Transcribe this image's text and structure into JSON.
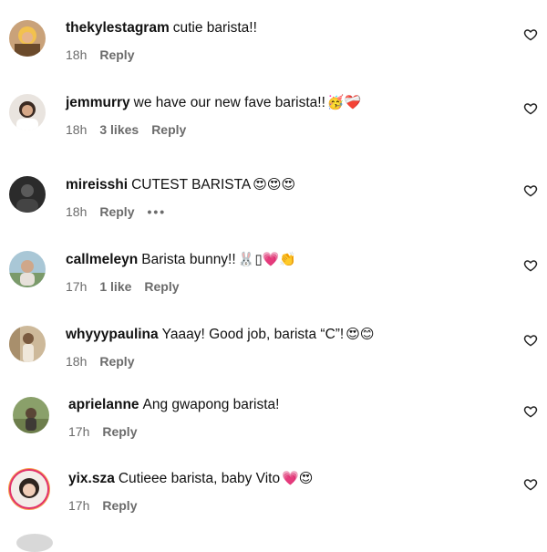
{
  "comments": [
    {
      "username": "thekylestagram",
      "text": "cutie barista!!",
      "emoji": "",
      "time": "18h",
      "likes": "",
      "reply": "Reply",
      "more": ""
    },
    {
      "username": "jemmurry",
      "text": "we have our new fave barista!!",
      "emoji": "🥳❤️‍🩹",
      "time": "18h",
      "likes": "3 likes",
      "reply": "Reply",
      "more": ""
    },
    {
      "username": "mireisshi",
      "text": "CUTEST BARISTA",
      "emoji": "😍😍😍",
      "time": "18h",
      "likes": "",
      "reply": "Reply",
      "more": "•••"
    },
    {
      "username": "callmeleyn",
      "text": "Barista bunny!!",
      "emoji": "🐰▯💗👏",
      "time": "17h",
      "likes": "1 like",
      "reply": "Reply",
      "more": ""
    },
    {
      "username": "whyyypaulina",
      "text": "Yaaay! Good job, barista “C”!",
      "emoji": "😍😊",
      "time": "18h",
      "likes": "",
      "reply": "Reply",
      "more": ""
    },
    {
      "username": "aprielanne",
      "text": "Ang gwapong barista!",
      "emoji": "",
      "time": "17h",
      "likes": "",
      "reply": "Reply",
      "more": ""
    },
    {
      "username": "yix.sza",
      "text": "Cutieee barista, baby Vito",
      "emoji": "💗😍",
      "time": "17h",
      "likes": "",
      "reply": "Reply",
      "more": ""
    }
  ],
  "colors": {
    "text": "#111111",
    "meta": "#6b6b6b",
    "heart_stroke": "#262626",
    "story_ring": "#e1306c"
  },
  "icons": {
    "like": "heart-outline-icon"
  }
}
